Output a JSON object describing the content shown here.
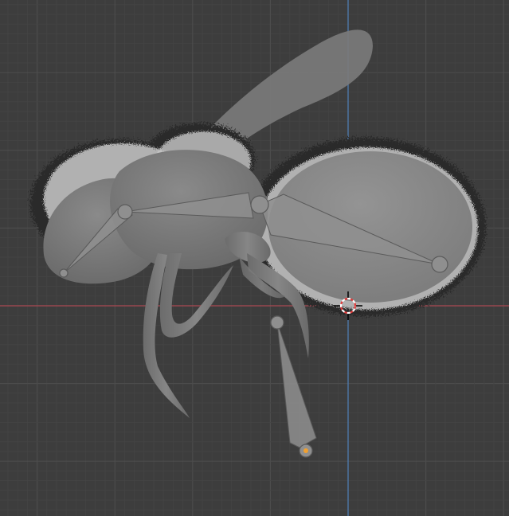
{
  "viewport": {
    "background_color": "#3d3d3d",
    "grid_minor_color": "#444444",
    "grid_major_color": "#4c4c4c",
    "axis_x_color": "#a8474f",
    "axis_y_color": "#4f7fb8",
    "mesh_color": "#7a7a7a",
    "mesh_shade_color": "#5e5e5e",
    "fur_color": "#c9c9c9",
    "fur_dark_color": "#2a2a2a",
    "bone_color": "#8f8f8f",
    "bone_edge_color": "#5a5a5a",
    "bone_selected_color": "#f0a030",
    "cursor_color_a": "#e03a3a",
    "cursor_color_b": "#ffffff"
  },
  "objects": {
    "mesh": "bee-mesh",
    "armature": "bee-armature",
    "bones": [
      "head-bone",
      "thorax-bone",
      "abdomen-bone",
      "leg-bone"
    ],
    "selected_bone_joint": "leg-bone-tail"
  },
  "icons": {
    "cursor": "3d-cursor-icon"
  }
}
